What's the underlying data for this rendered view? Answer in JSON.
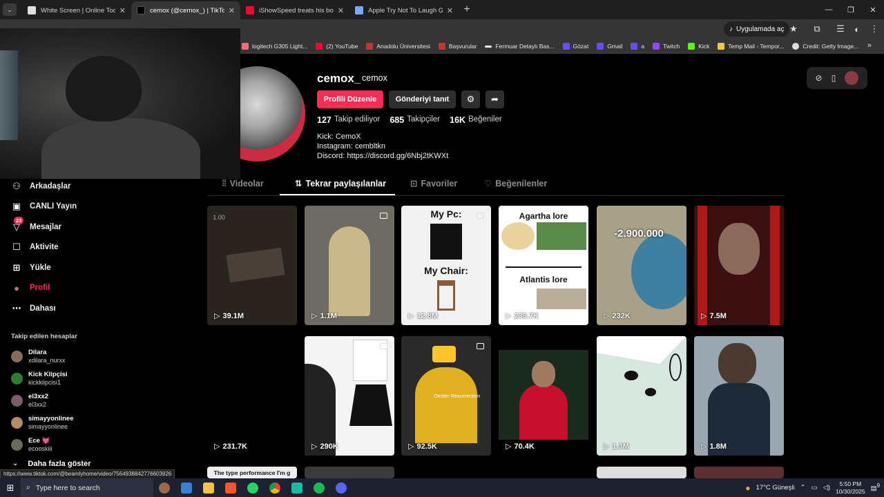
{
  "browser": {
    "tabs": [
      {
        "title": "White Screen | Online Tool",
        "color": "#2b2b2b"
      },
      {
        "title": "cemox (@cemox_) | TikTok",
        "color": "#111111"
      },
      {
        "title": "iShowSpeed treats his bodygua",
        "color": "#ff0033"
      },
      {
        "title": "Apple Try Not To Laugh GIF - Fi",
        "color": "#7aa7ff"
      }
    ],
    "app_button": "Uygulamada aç",
    "bookmarks": [
      {
        "label": "logitech G305 Light...",
        "color": "#ff6b6b"
      },
      {
        "label": "(2) YouTube",
        "color": "#ff0033"
      },
      {
        "label": "Anadolu Üniversitesi",
        "color": "#c0392b"
      },
      {
        "label": "Başvurular",
        "color": "#c0392b"
      },
      {
        "label": "Fermuar Detaylı Bas...",
        "color": "#eeeeee"
      },
      {
        "label": "Gözat",
        "color": "#6b4bff"
      },
      {
        "label": "Gmail",
        "color": "#6b4bff"
      },
      {
        "label": "a",
        "color": "#6b4bff"
      },
      {
        "label": "Twitch",
        "color": "#9146ff"
      },
      {
        "label": "Kick",
        "color": "#53fc18"
      },
      {
        "label": "Temp Mail - Tempor...",
        "color": "#f5c542"
      },
      {
        "label": "Credit: Getty Image...",
        "color": "#dddddd"
      }
    ]
  },
  "sidebar": {
    "items": [
      {
        "label": "Arkadaşlar",
        "icon": "friends-icon",
        "glyph": "⚇"
      },
      {
        "label": "CANLI Yayın",
        "icon": "live-icon",
        "glyph": "▣"
      },
      {
        "label": "Mesajlar",
        "icon": "inbox-icon",
        "glyph": "▽"
      },
      {
        "label": "Aktivite",
        "icon": "activity-icon",
        "glyph": "☐"
      },
      {
        "label": "Yükle",
        "icon": "upload-icon",
        "glyph": "⊞"
      },
      {
        "label": "Profil",
        "icon": "profile-icon",
        "glyph": "●"
      },
      {
        "label": "Dahası",
        "icon": "more-icon",
        "glyph": "⋯"
      }
    ],
    "messages_badge": "23",
    "following_title": "Takip edilen hesaplar",
    "accounts": [
      {
        "name": "Dilara",
        "handle": "xdilara_nurxx",
        "color": "#8a6a5a"
      },
      {
        "name": "Kick Klipçisi",
        "handle": "kickklipcisi1",
        "color": "#2e7d32"
      },
      {
        "name": "el3xx2",
        "handle": "el3xx2",
        "color": "#7a5c6a"
      },
      {
        "name": "simayyonlinee",
        "handle": "simayyonlinee",
        "color": "#b38a6a"
      },
      {
        "name": "Ece 💓",
        "handle": "ecooskiii",
        "color": "#6a6a5a"
      }
    ],
    "more_label": "Daha fazla göster"
  },
  "profile": {
    "username": "cemox_",
    "nickname": "cemox",
    "edit_label": "Profili Düzenle",
    "promote_label": "Gönderiyi tanıt",
    "following_count": "127",
    "following_label": "Takip ediliyor",
    "followers_count": "685",
    "followers_label": "Takipçiler",
    "likes_count": "16K",
    "likes_label": "Beğeniler",
    "bio": [
      "Kick: CemoX",
      "Instagram: cembltkn",
      "Discord: https://discord.gg/6Nbj2tKWXt"
    ]
  },
  "tabs": [
    {
      "label": "Videolar",
      "glyph": "⦙⦙"
    },
    {
      "label": "Tekrar paylaşılanlar",
      "glyph": "⇅"
    },
    {
      "label": "Favoriler",
      "glyph": "⊡"
    },
    {
      "label": "Beğenilenler",
      "glyph": "♡"
    }
  ],
  "videos": [
    {
      "views": "39.1M",
      "bg": "#2a241f",
      "caption": "1.00",
      "multi": false
    },
    {
      "views": "1.1M",
      "bg": "#6e6a64",
      "caption": "",
      "multi": true
    },
    {
      "views": "12.8M",
      "bg": "#f2f2f2",
      "caption": "My Pc:",
      "caption2": "My Chair:",
      "multi": true
    },
    {
      "views": "239.7K",
      "bg": "#ffffff",
      "caption": "Agartha lore",
      "caption2": "Atlantis lore",
      "multi": false
    },
    {
      "views": "232K",
      "bg": "#a8a188",
      "caption": "-2.900.000",
      "multi": false
    },
    {
      "views": "7.5M",
      "bg": "#3a1010",
      "caption": "",
      "multi": false
    },
    {
      "views": "231.7K",
      "bg": "#000000",
      "caption": "",
      "multi": false
    },
    {
      "views": "290K",
      "bg": "#f4f4f4",
      "caption": "",
      "multi": true
    },
    {
      "views": "92.5K",
      "bg": "#2a2a2a",
      "caption": "Dexter Resurrection",
      "multi": true
    },
    {
      "views": "70.4K",
      "bg": "#1b2a1e",
      "caption": "",
      "multi": false
    },
    {
      "views": "1.3M",
      "bg": "#d7e6df",
      "caption": "",
      "multi": false
    },
    {
      "views": "1.8M",
      "bg": "#9aa7b0",
      "caption": "",
      "multi": false
    }
  ],
  "partial_row_caption": "The type performance I'm g",
  "status_url": "https://www.tiktok.com/@beamlyhome/video/7564938842776603926",
  "taskbar": {
    "search_placeholder": "Type here to search",
    "weather": "17°C  Güneşli",
    "time": "5:50 PM",
    "date": "10/30/2025",
    "notif": "9"
  }
}
